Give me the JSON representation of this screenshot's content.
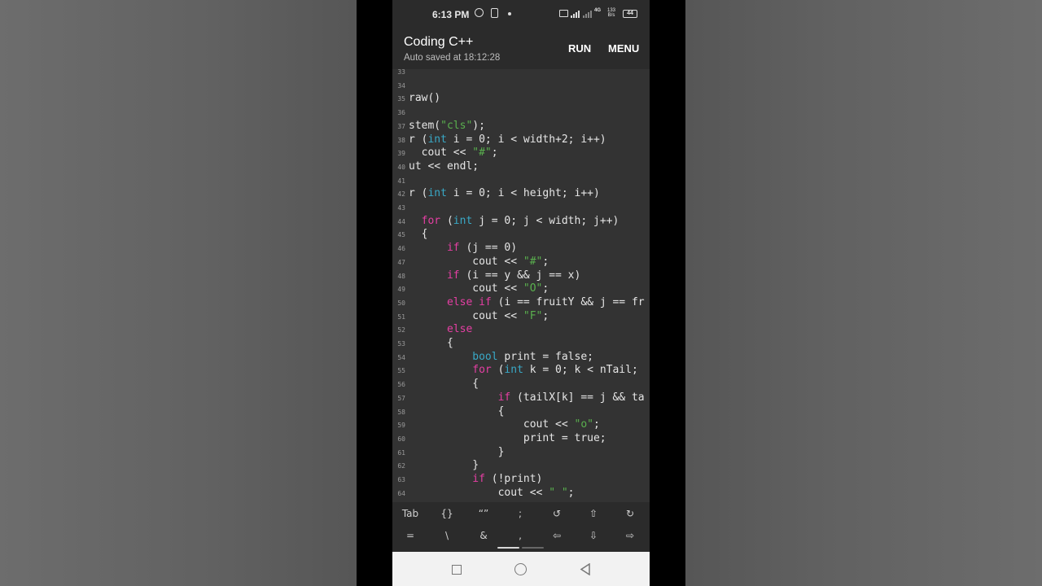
{
  "status": {
    "time": "6:13 PM",
    "network": "4G",
    "speed_value": "133",
    "speed_unit": "B/s",
    "battery": "44"
  },
  "appbar": {
    "title": "Coding C++",
    "subtitle": "Auto saved at 18:12:28",
    "run_label": "RUN",
    "menu_label": "MENU"
  },
  "editor": {
    "lines": [
      {
        "n": "33",
        "code": ""
      },
      {
        "n": "34",
        "code": ""
      },
      {
        "n": "35",
        "code": "raw()"
      },
      {
        "n": "36",
        "code": ""
      },
      {
        "n": "37",
        "code": "stem(\"cls\");"
      },
      {
        "n": "38",
        "code": "r (int i = 0; i < width+2; i++)"
      },
      {
        "n": "39",
        "code": "  cout << \"#\";"
      },
      {
        "n": "40",
        "code": "ut << endl;"
      },
      {
        "n": "41",
        "code": ""
      },
      {
        "n": "42",
        "code": "r (int i = 0; i < height; i++)"
      },
      {
        "n": "43",
        "code": ""
      },
      {
        "n": "44",
        "code": "  for (int j = 0; j < width; j++)"
      },
      {
        "n": "45",
        "code": "  {"
      },
      {
        "n": "46",
        "code": "      if (j == 0)"
      },
      {
        "n": "47",
        "code": "          cout << \"#\";"
      },
      {
        "n": "48",
        "code": "      if (i == y && j == x)"
      },
      {
        "n": "49",
        "code": "          cout << \"O\";"
      },
      {
        "n": "50",
        "code": "      else if (i == fruitY && j == fr"
      },
      {
        "n": "51",
        "code": "          cout << \"F\";"
      },
      {
        "n": "52",
        "code": "      else"
      },
      {
        "n": "53",
        "code": "      {"
      },
      {
        "n": "54",
        "code": "          bool print = false;"
      },
      {
        "n": "55",
        "code": "          for (int k = 0; k < nTail;"
      },
      {
        "n": "56",
        "code": "          {"
      },
      {
        "n": "57",
        "code": "              if (tailX[k] == j && ta"
      },
      {
        "n": "58",
        "code": "              {"
      },
      {
        "n": "59",
        "code": "                  cout << \"o\";"
      },
      {
        "n": "60",
        "code": "                  print = true;"
      },
      {
        "n": "61",
        "code": "              }"
      },
      {
        "n": "62",
        "code": "          }"
      },
      {
        "n": "63",
        "code": "          if (!print)"
      },
      {
        "n": "64",
        "code": "              cout << \" \";"
      }
    ]
  },
  "keyboard": {
    "row1": [
      "Tab",
      "{}",
      "“”",
      ";",
      "↺",
      "⇧",
      "↻"
    ],
    "row2": [
      "=",
      "\\",
      "&",
      ",",
      "⇦",
      "⇩",
      "⇨"
    ]
  },
  "navbar": {
    "recents": "recents-icon",
    "home": "home-icon",
    "back": "back-icon"
  },
  "colors": {
    "keyword": "#e63fa4",
    "type": "#39a9c7",
    "string": "#5ab04e",
    "text": "#e6e6e6",
    "editor_bg": "#333333"
  }
}
